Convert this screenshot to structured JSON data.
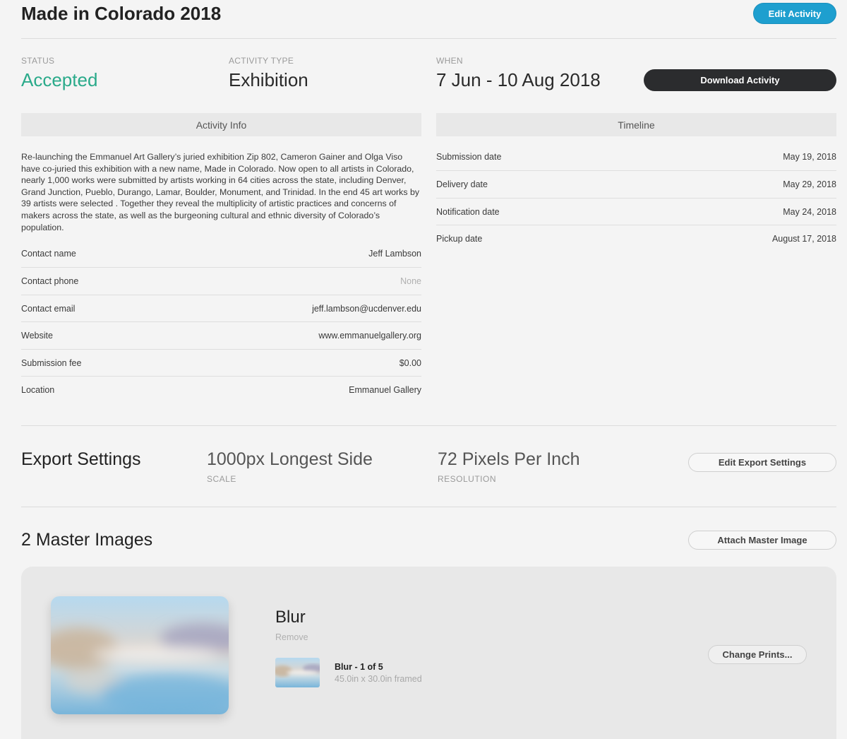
{
  "header": {
    "title": "Made in Colorado 2018",
    "edit_label": "Edit Activity"
  },
  "meta": {
    "status_label": "STATUS",
    "status_value": "Accepted",
    "type_label": "ACTIVITY TYPE",
    "type_value": "Exhibition",
    "when_label": "WHEN",
    "when_value": "7 Jun - 10 Aug 2018",
    "download_label": "Download Activity"
  },
  "activity_info": {
    "header": "Activity Info",
    "description": "Re-launching the Emmanuel Art Gallery’s juried exhibition Zip 802, Cameron Gainer and Olga Viso have co-juried this exhibition with a new name, Made in Colorado. Now open to all artists in Colorado, nearly 1,000 works were submitted by artists working in 64 cities across the state, including Denver, Grand Junction, Pueblo, Durango, Lamar, Boulder, Monument, and Trinidad. In the end 45 art works by 39 artists were selected . Together they reveal the multiplicity of artistic practices and concerns of makers across the state, as well as the burgeoning cultural and ethnic diversity of Colorado’s population.",
    "rows": [
      {
        "label": "Contact name",
        "value": "Jeff Lambson"
      },
      {
        "label": "Contact phone",
        "value": "None"
      },
      {
        "label": "Contact email",
        "value": "jeff.lambson@ucdenver.edu"
      },
      {
        "label": "Website",
        "value": "www.emmanuelgallery.org"
      },
      {
        "label": "Submission fee",
        "value": "$0.00"
      },
      {
        "label": "Location",
        "value": "Emmanuel Gallery"
      }
    ]
  },
  "timeline": {
    "header": "Timeline",
    "rows": [
      {
        "label": "Submission date",
        "value": "May 19, 2018"
      },
      {
        "label": "Delivery date",
        "value": "May 29, 2018"
      },
      {
        "label": "Notification date",
        "value": "May 24, 2018"
      },
      {
        "label": "Pickup date",
        "value": "August 17, 2018"
      }
    ]
  },
  "export_settings": {
    "title": "Export Settings",
    "scale_value": "1000px Longest Side",
    "scale_label": "SCALE",
    "resolution_value": "72 Pixels Per Inch",
    "resolution_label": "RESOLUTION",
    "edit_label": "Edit Export Settings"
  },
  "master_images": {
    "title": "2 Master Images",
    "attach_label": "Attach Master Image",
    "items": [
      {
        "name": "Blur",
        "remove_label": "Remove",
        "print_title": "Blur - 1 of 5",
        "print_size": "45.0in x 30.0in framed",
        "change_label": "Change Prints..."
      }
    ]
  },
  "colors": {
    "accent_blue": "#1e9fcf",
    "status_green": "#2aaa8a",
    "dark_button": "#2b2c2e"
  }
}
